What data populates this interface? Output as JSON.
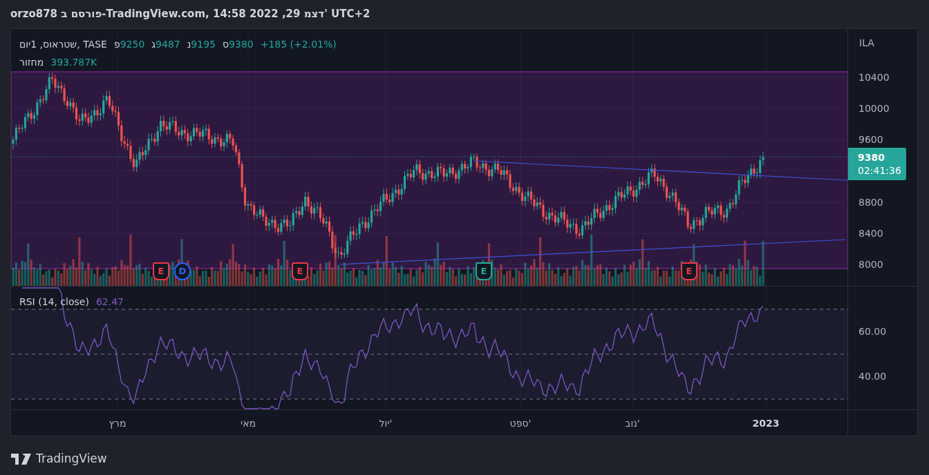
{
  "header": {
    "text": "orzo878 פורסם ב-TradingView.com, 14:58 2022 ,29 דצמ' UTC+2"
  },
  "legend": {
    "symbol": "שטראוס, 1יום, TASE",
    "open": {
      "label": "פ",
      "value": "9250"
    },
    "high": {
      "label": "ג",
      "value": "9487"
    },
    "low": {
      "label": "נ",
      "value": "9195"
    },
    "close": {
      "label": "ס",
      "value": "9380"
    },
    "change": "+185 (+2.01%)",
    "volume_label": "מחזור",
    "volume_value": "393.787K"
  },
  "price_axis": {
    "currency": "ILA",
    "ticks": [
      "10400",
      "10000",
      "9600",
      "8800",
      "8400",
      "8000"
    ],
    "last_price": "9380",
    "countdown": "02:41:36"
  },
  "events": [
    {
      "kind": "earnings",
      "label": "E",
      "color": "#f23645"
    },
    {
      "kind": "dividend",
      "label": "D",
      "color": "#2962ff"
    },
    {
      "kind": "earnings",
      "label": "E",
      "color": "#f23645"
    },
    {
      "kind": "earnings",
      "label": "E",
      "color": "#22ab94"
    },
    {
      "kind": "earnings",
      "label": "E",
      "color": "#f23645"
    }
  ],
  "rsi": {
    "title": "RSI (14, close)",
    "value": "62.47",
    "ticks": [
      "60.00",
      "40.00"
    ]
  },
  "time_axis": [
    {
      "label": "2023",
      "bold": true
    },
    {
      "label": "נוב'",
      "bold": false
    },
    {
      "label": "ספט'",
      "bold": false
    },
    {
      "label": "יול'",
      "bold": false
    },
    {
      "label": "מאי",
      "bold": false
    },
    {
      "label": "מרץ",
      "bold": false
    }
  ],
  "footer": {
    "logo_text": "TradingView"
  }
}
